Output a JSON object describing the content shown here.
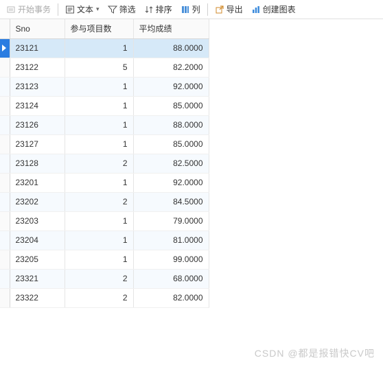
{
  "toolbar": {
    "begin_tx": "开始事务",
    "text": "文本",
    "filter": "筛选",
    "sort": "排序",
    "columns": "列",
    "export": "导出",
    "chart": "创建图表"
  },
  "columns": {
    "sno": "Sno",
    "cnt": "参与项目数",
    "avg": "平均成绩"
  },
  "rows": [
    {
      "sno": "23121",
      "cnt": "1",
      "avg": "88.0000",
      "sel": true
    },
    {
      "sno": "23122",
      "cnt": "5",
      "avg": "82.2000"
    },
    {
      "sno": "23123",
      "cnt": "1",
      "avg": "92.0000",
      "alt": true
    },
    {
      "sno": "23124",
      "cnt": "1",
      "avg": "85.0000"
    },
    {
      "sno": "23126",
      "cnt": "1",
      "avg": "88.0000",
      "alt": true
    },
    {
      "sno": "23127",
      "cnt": "1",
      "avg": "85.0000"
    },
    {
      "sno": "23128",
      "cnt": "2",
      "avg": "82.5000",
      "alt": true
    },
    {
      "sno": "23201",
      "cnt": "1",
      "avg": "92.0000"
    },
    {
      "sno": "23202",
      "cnt": "2",
      "avg": "84.5000",
      "alt": true
    },
    {
      "sno": "23203",
      "cnt": "1",
      "avg": "79.0000"
    },
    {
      "sno": "23204",
      "cnt": "1",
      "avg": "81.0000",
      "alt": true
    },
    {
      "sno": "23205",
      "cnt": "1",
      "avg": "99.0000"
    },
    {
      "sno": "23321",
      "cnt": "2",
      "avg": "68.0000",
      "alt": true
    },
    {
      "sno": "23322",
      "cnt": "2",
      "avg": "82.0000"
    }
  ],
  "watermark": "CSDN @都是报错快CV吧"
}
